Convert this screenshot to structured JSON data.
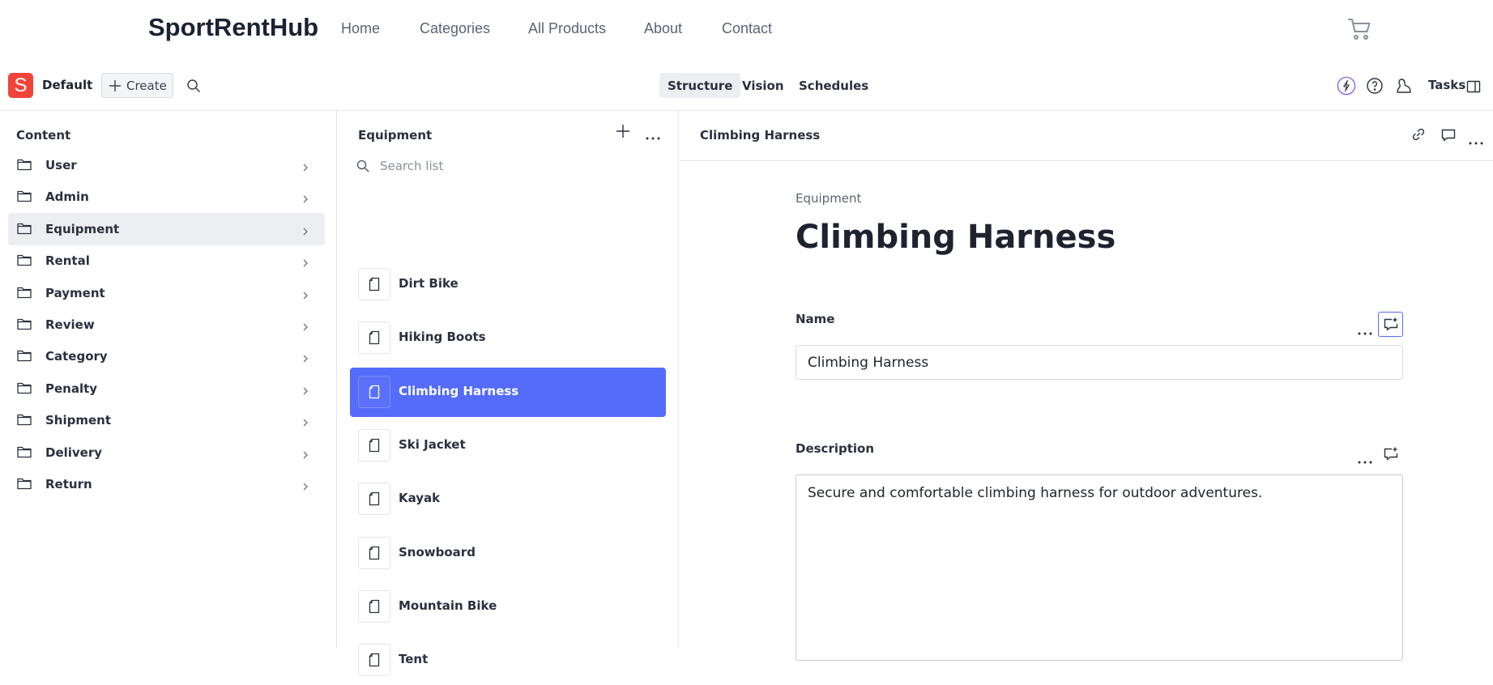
{
  "site": {
    "brand": "SportRentHub",
    "nav": [
      "Home",
      "Categories",
      "All Products",
      "About",
      "Contact"
    ]
  },
  "studio": {
    "logo_letter": "S",
    "workspace": "Default",
    "create_label": "Create",
    "modes": [
      "Structure",
      "Vision",
      "Schedules"
    ],
    "active_mode": "Structure",
    "tasks_label": "Tasks",
    "accent": "#556cfa",
    "logo_color": "#f0443a"
  },
  "content_pane": {
    "title": "Content",
    "items": [
      "User",
      "Admin",
      "Equipment",
      "Rental",
      "Payment",
      "Review",
      "Category",
      "Penalty",
      "Shipment",
      "Delivery",
      "Return"
    ],
    "active": "Equipment"
  },
  "list_pane": {
    "title": "Equipment",
    "search_placeholder": "Search list",
    "items": [
      "Dirt Bike",
      "Hiking Boots",
      "Climbing Harness",
      "Ski Jacket",
      "Kayak",
      "Snowboard",
      "Mountain Bike",
      "Tent"
    ],
    "active": "Climbing Harness"
  },
  "document": {
    "header_title": "Climbing Harness",
    "type_label": "Equipment",
    "title": "Climbing Harness",
    "fields": {
      "name_label": "Name",
      "name_value": "Climbing Harness",
      "description_label": "Description",
      "description_value": "Secure and comfortable climbing harness for outdoor adventures."
    }
  }
}
